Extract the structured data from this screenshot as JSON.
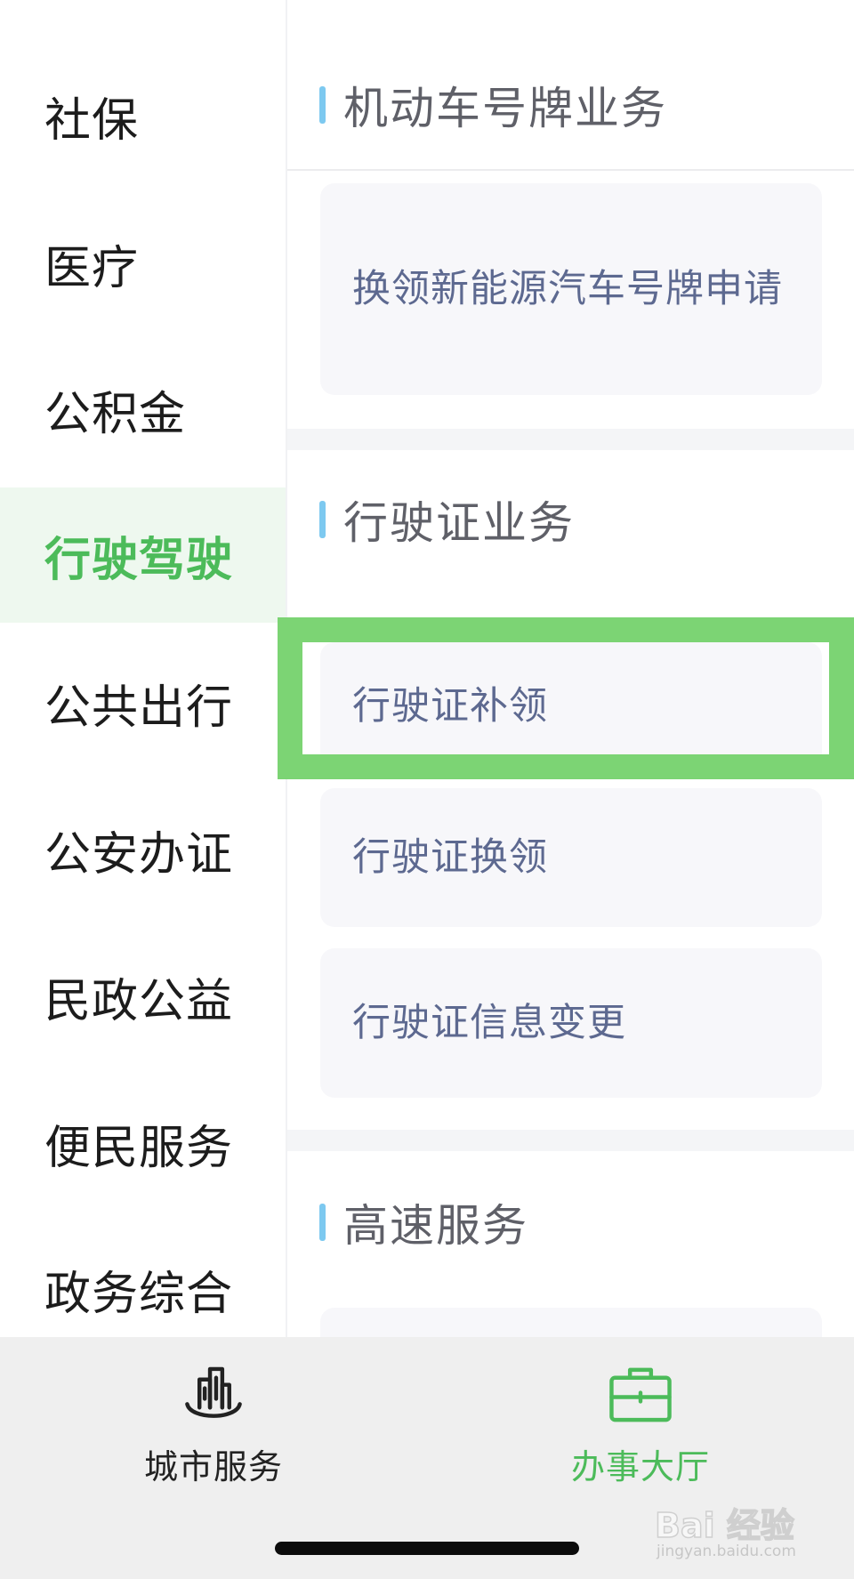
{
  "sidebar": {
    "items": [
      {
        "label": "社保"
      },
      {
        "label": "医疗"
      },
      {
        "label": "公积金"
      },
      {
        "label": "行驶驾驶"
      },
      {
        "label": "公共出行"
      },
      {
        "label": "公安办证"
      },
      {
        "label": "民政公益"
      },
      {
        "label": "便民服务"
      },
      {
        "label": "政务综合"
      }
    ],
    "active_index": 3
  },
  "content": {
    "sections": [
      {
        "title": "机动车号牌业务",
        "items": [
          {
            "label": "换领新能源汽车号牌申请"
          }
        ]
      },
      {
        "title": "行驶证业务",
        "items": [
          {
            "label": "行驶证补领"
          },
          {
            "label": "行驶证换领"
          },
          {
            "label": "行驶证信息变更"
          }
        ]
      },
      {
        "title": "高速服务",
        "items": []
      }
    ]
  },
  "highlight": {
    "target": "行驶证补领",
    "color": "#7cd474"
  },
  "tabbar": {
    "tabs": [
      {
        "label": "城市服务",
        "icon": "city-buildings-icon",
        "active": false
      },
      {
        "label": "办事大厅",
        "icon": "briefcase-icon",
        "active": true
      }
    ]
  },
  "watermark": {
    "line1": "Bai 经验",
    "line2": "jingyan.baidu.com"
  },
  "colors": {
    "accent_green": "#4cbb5a",
    "active_bg": "#eef8ef",
    "title_marker": "#7dc9f0",
    "card_bg": "#f7f7fa",
    "card_text": "#5d6990"
  }
}
